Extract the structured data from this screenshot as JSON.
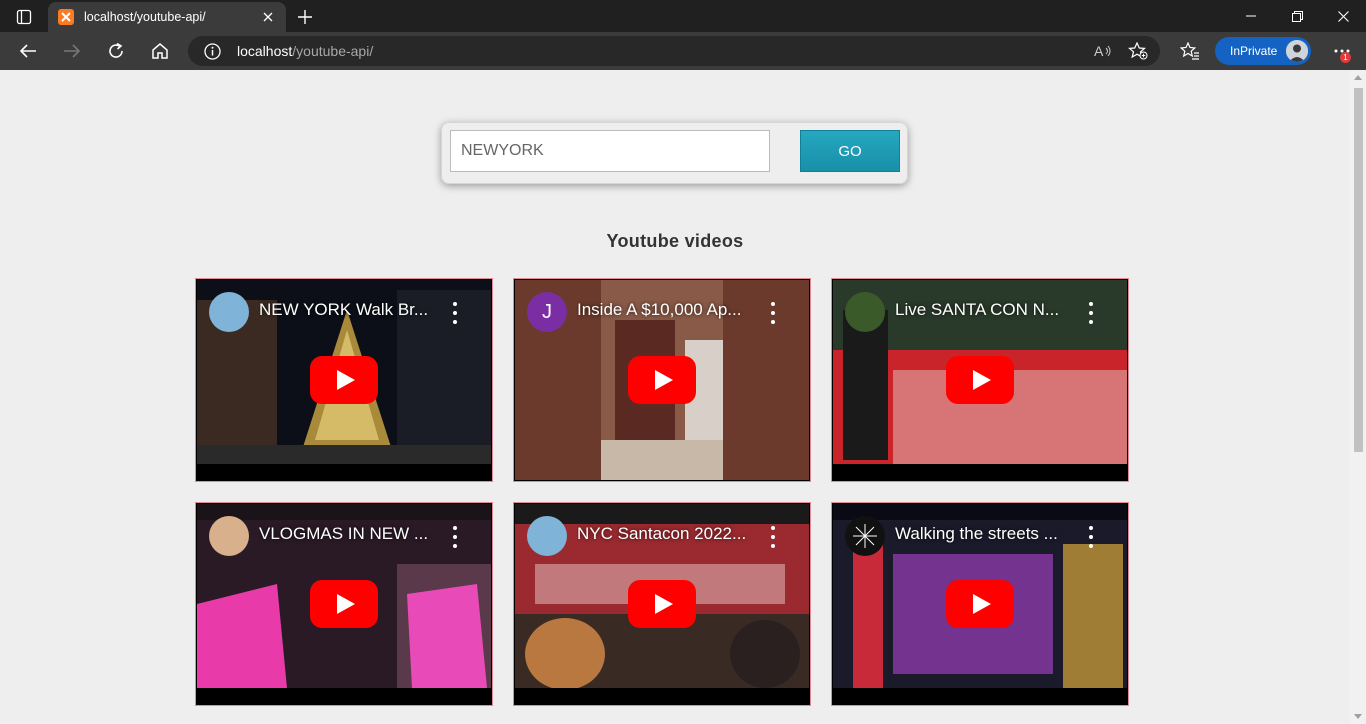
{
  "browser": {
    "tab_title": "localhost/youtube-api/",
    "url_host": "localhost",
    "url_path": "/youtube-api/",
    "inprivate_label": "InPrivate",
    "notification_count": "1"
  },
  "search": {
    "value": "NEWYORK",
    "button_label": "GO"
  },
  "section_title": "Youtube videos",
  "videos": [
    {
      "title": "NEW YORK Walk Br...",
      "avatar_letter": "",
      "avatar_color": "#7fb4d8"
    },
    {
      "title": "Inside A $10,000 Ap...",
      "avatar_letter": "J",
      "avatar_color": "#7b2ea3"
    },
    {
      "title": "Live SANTA CON N...",
      "avatar_letter": "",
      "avatar_color": "#3a5a2a"
    },
    {
      "title": "VLOGMAS IN NEW ...",
      "avatar_letter": "",
      "avatar_color": "#d9b08c"
    },
    {
      "title": "NYC Santacon 2022...",
      "avatar_letter": "",
      "avatar_color": "#7fb4d8"
    },
    {
      "title": "Walking the streets ...",
      "avatar_letter": "",
      "avatar_color": "#111111"
    }
  ],
  "colors": {
    "youtube_red": "#ff0000",
    "go_button": "#1e9bb3",
    "card_border": "#e08a9a"
  }
}
